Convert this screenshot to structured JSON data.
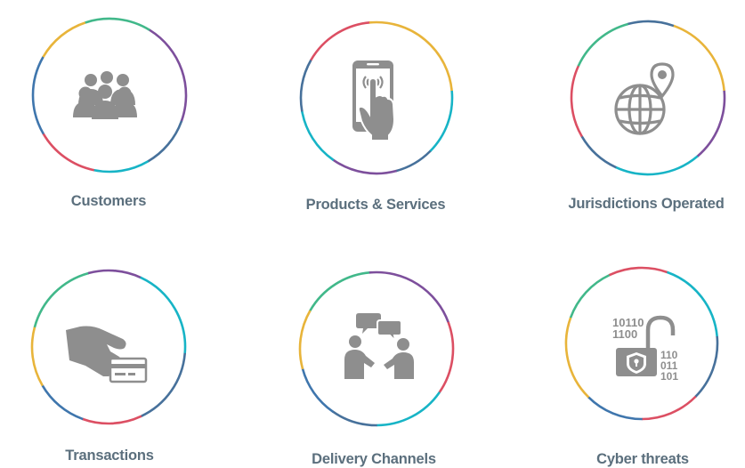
{
  "colors": {
    "icon": "#8e8e8e",
    "label": "#5b6f7d",
    "ring_segments": [
      "#e8b43a",
      "#41b88a",
      "#7d4f9c",
      "#47719b",
      "#17b4c6",
      "#dc4f63",
      "#3f76ad"
    ]
  },
  "items": [
    {
      "label": "Customers",
      "icon": "people-group-icon"
    },
    {
      "label": "Products & Services",
      "icon": "phone-touch-icon"
    },
    {
      "label": "Jurisdictions Operated",
      "icon": "globe-pin-icon"
    },
    {
      "label": "Transactions",
      "icon": "hand-card-icon"
    },
    {
      "label": "Delivery Channels",
      "icon": "chat-people-icon"
    },
    {
      "label": "Cyber threats",
      "icon": "cyber-lock-icon"
    }
  ]
}
